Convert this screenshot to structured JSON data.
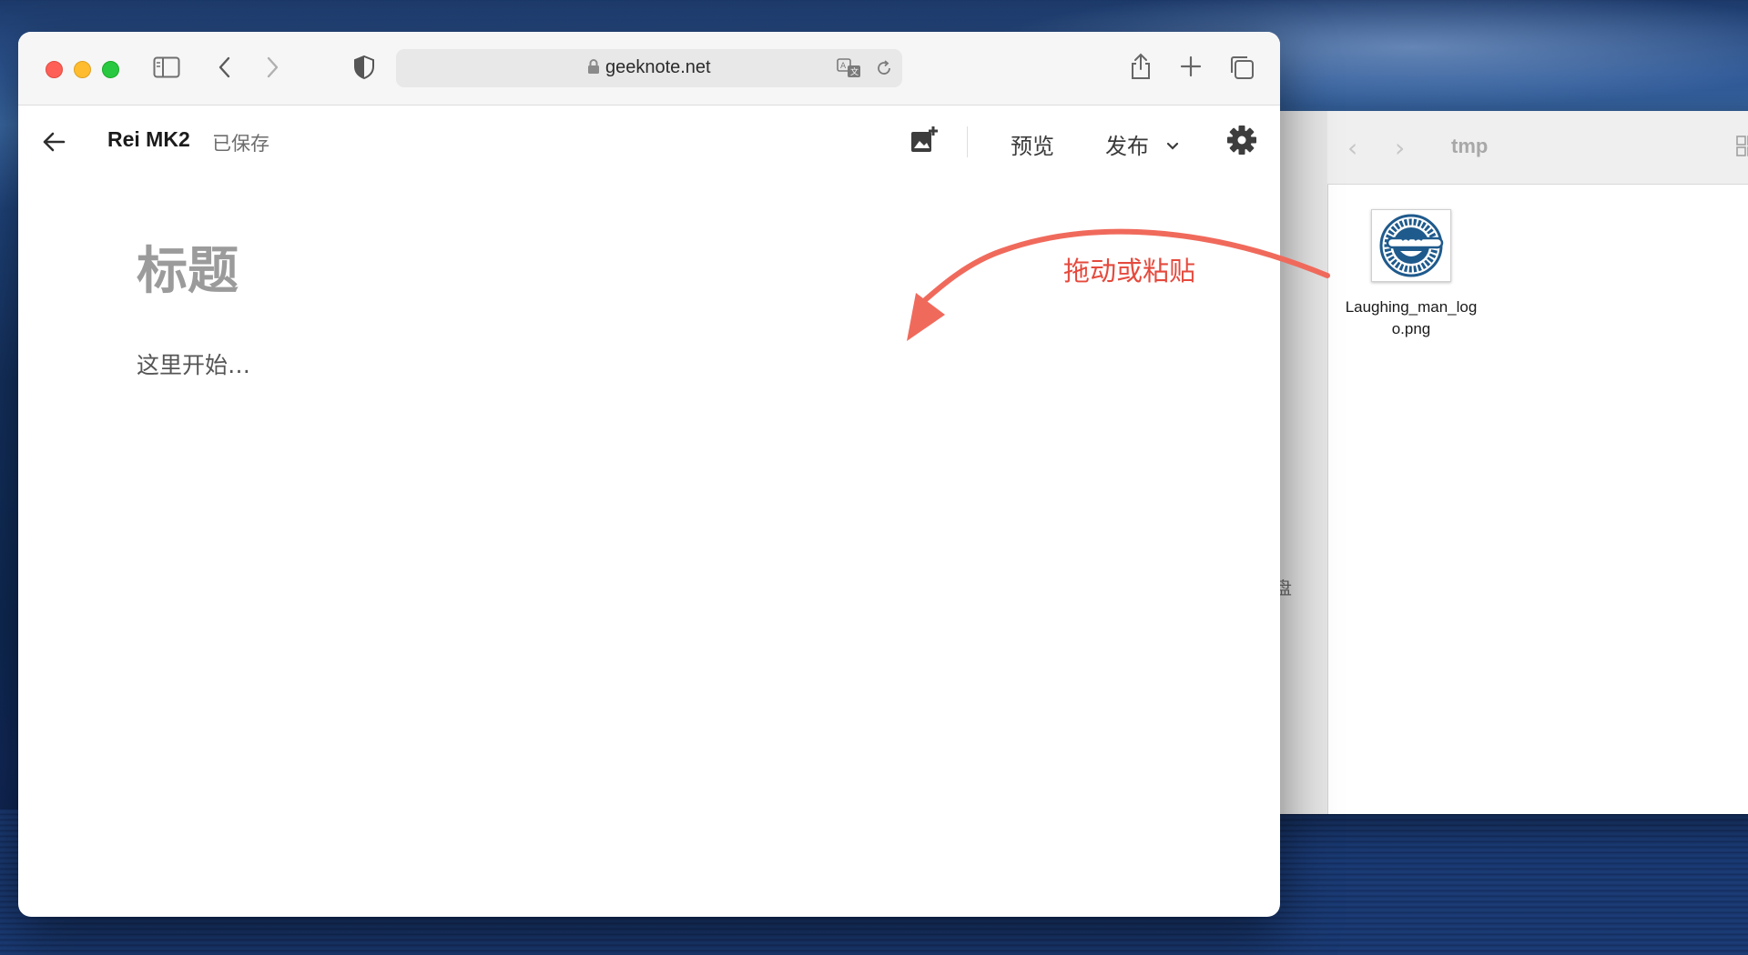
{
  "desktop": {
    "wallpaper": "ocean-dusk"
  },
  "finder": {
    "title": "tmp",
    "sidebar_fragment": "盘",
    "file": {
      "name": "Laughing_man_logo.png",
      "thumbnail_icon": "laughing-man-logo-icon"
    },
    "icons": [
      "chevron-left-icon",
      "chevron-right-icon",
      "grid-view-icon"
    ]
  },
  "safari": {
    "url": "geeknote.net",
    "icons": [
      "sidebar-icon",
      "chevron-left-icon",
      "chevron-right-icon",
      "shield-icon",
      "lock-icon",
      "translate-icon",
      "reload-icon",
      "share-icon",
      "plus-icon",
      "tabs-icon"
    ]
  },
  "editor": {
    "doc_title": "Rei MK2",
    "save_status": "已保存",
    "preview_label": "预览",
    "publish_label": "发布",
    "title_placeholder": "标题",
    "body_placeholder": "这里开始…",
    "icons": [
      "back-arrow-icon",
      "add-image-icon",
      "chevron-down-icon",
      "gear-icon"
    ]
  },
  "annotation": {
    "hint": "拖动或粘贴",
    "color": "#e54a3d"
  },
  "colors": {
    "traffic_red": "#fe5f57",
    "traffic_yellow": "#febc2e",
    "traffic_green": "#28c840"
  }
}
